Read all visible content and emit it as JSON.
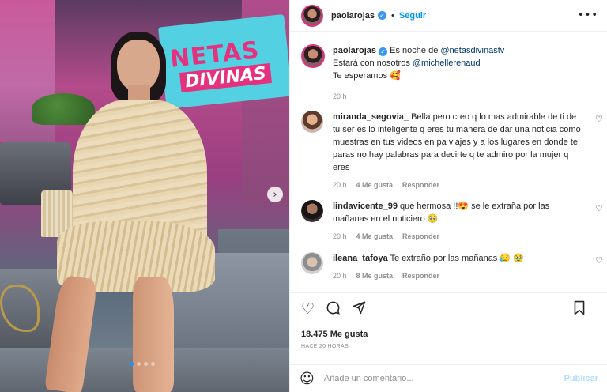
{
  "header": {
    "username": "paolarojas",
    "follow_label": "Seguir",
    "more_icon": "more-horizontal-icon"
  },
  "caption": {
    "username": "paolarojas",
    "line1_prefix": "Es noche de ",
    "line1_mention": "@netasdivinastv",
    "line2_prefix": "Estará con nosotros ",
    "line2_mention": "@michellerenaud",
    "line3": "Te esperamos 🥰",
    "time": "20 h"
  },
  "comments": [
    {
      "username": "miranda_segovia_",
      "text": "Bella pero creo q lo mas admirable de ti de tu ser es lo inteligente q eres tú manera de dar una noticia como muestras en tus videos en pa viajes y a los lugares en donde te paras no hay palabras para decirte q te admiro por la mujer q eres",
      "time": "20 h",
      "likes": "4 Me gusta",
      "reply": "Responder"
    },
    {
      "username": "lindavicente_99",
      "text": "que hermosa !!😍 se le extraña por las mañanas en el noticiero 🥹",
      "time": "20 h",
      "likes": "4 Me gusta",
      "reply": "Responder"
    },
    {
      "username": "ileana_tafoya",
      "text": "Te extraño por las mañanas 😥 🥹",
      "time": "20 h",
      "likes": "8 Me gusta",
      "reply": "Responder"
    }
  ],
  "actions": {
    "likes": "18.475 Me gusta",
    "ago": "HACE 20 HORAS"
  },
  "comment_box": {
    "placeholder": "Añade un comentario...",
    "publish": "Publicar"
  },
  "media": {
    "sign_top": "NETAS",
    "sign_bottom": "DIVINAS",
    "slide_count": 4,
    "active_slide": 1
  },
  "colors": {
    "link": "#00376b",
    "follow": "#0095f6",
    "verified": "#3897f0",
    "publish_disabled": "#b2dffc"
  }
}
